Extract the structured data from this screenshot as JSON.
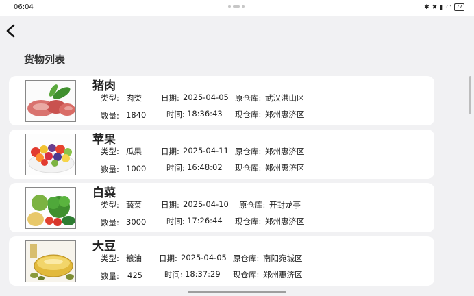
{
  "status": {
    "time": "06:04",
    "battery": "77"
  },
  "page": {
    "title": "货物列表"
  },
  "items": [
    {
      "name": "猪肉",
      "type_label": "类型:",
      "type": "肉类",
      "date_label": "日期:",
      "date": "2025-04-05",
      "orig_label": "原仓库:",
      "orig": "武汉洪山区",
      "qty_label": "数量:",
      "qty": "1840",
      "time_label": "时间:",
      "time": "18:36:43",
      "cur_label": "现仓库:",
      "cur": "郑州惠济区",
      "image": "meat-image"
    },
    {
      "name": "苹果",
      "type_label": "类型:",
      "type": "瓜果",
      "date_label": "日期:",
      "date": "2025-04-11",
      "orig_label": "原仓库:",
      "orig": "郑州惠济区",
      "qty_label": "数量:",
      "qty": "1000",
      "time_label": "时间:",
      "time": "16:48:02",
      "cur_label": "现仓库:",
      "cur": "郑州惠济区",
      "image": "fruit-image"
    },
    {
      "name": "白菜",
      "type_label": "类型:",
      "type": "蔬菜",
      "date_label": "日期:",
      "date": "2025-04-10",
      "orig_label": "原仓库:",
      "orig": "开封龙亭",
      "qty_label": "数量:",
      "qty": "3000",
      "time_label": "时间:",
      "time": "17:26:44",
      "cur_label": "现仓库:",
      "cur": "郑州惠济区",
      "image": "vegetable-image"
    },
    {
      "name": "大豆",
      "type_label": "类型:",
      "type": "粮油",
      "date_label": "日期:",
      "date": "2025-04-05",
      "orig_label": "原仓库:",
      "orig": "南阳宛城区",
      "qty_label": "数量:",
      "qty": "425",
      "time_label": "时间:",
      "time": "18:37:29",
      "cur_label": "现仓库:",
      "cur": "郑州惠济区",
      "image": "oil-image"
    }
  ]
}
